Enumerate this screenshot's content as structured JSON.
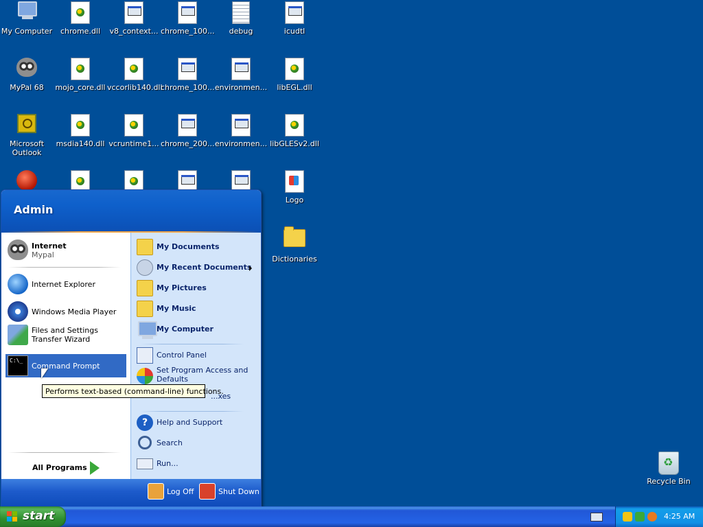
{
  "desktop": {
    "icons": [
      {
        "label": "My Computer"
      },
      {
        "label": "chrome.dll"
      },
      {
        "label": "v8_context..."
      },
      {
        "label": "chrome_100..."
      },
      {
        "label": "debug"
      },
      {
        "label": "icudtl"
      },
      {
        "label": "MyPal 68"
      },
      {
        "label": "mojo_core.dll"
      },
      {
        "label": "vccorlib140.dll"
      },
      {
        "label": "chrome_100..."
      },
      {
        "label": "environmen..."
      },
      {
        "label": "libEGL.dll"
      },
      {
        "label": "Microsoft Outlook"
      },
      {
        "label": "msdia140.dll"
      },
      {
        "label": "vcruntime1..."
      },
      {
        "label": "chrome_200..."
      },
      {
        "label": "environmen..."
      },
      {
        "label": "libGLESv2.dll"
      },
      {
        "label": "Logo"
      },
      {
        "label": "Dictionaries"
      },
      {
        "label": "Recycle Bin"
      }
    ]
  },
  "start_menu": {
    "user": "Admin",
    "pinned": [
      {
        "title": "Internet",
        "subtitle": "Mypal"
      }
    ],
    "recent": [
      {
        "title": "Internet Explorer"
      },
      {
        "title": "Windows Media Player"
      },
      {
        "title": "Files and Settings Transfer Wizard"
      },
      {
        "title": "Command Prompt"
      }
    ],
    "all_programs": "All Programs",
    "places": [
      {
        "title": "My Documents"
      },
      {
        "title": "My Recent Documents"
      },
      {
        "title": "My Pictures"
      },
      {
        "title": "My Music"
      },
      {
        "title": "My Computer"
      }
    ],
    "system": [
      {
        "title": "Control Panel"
      },
      {
        "title": "Set Program Access and Defaults"
      },
      {
        "title": "...xes"
      }
    ],
    "tools": [
      {
        "title": "Help and Support"
      },
      {
        "title": "Search"
      },
      {
        "title": "Run..."
      }
    ],
    "log_off": "Log Off",
    "shut_down": "Shut Down"
  },
  "tooltip": "Performs text-based (command-line) functions.",
  "taskbar": {
    "start_label": "start",
    "clock": "4:25 AM"
  },
  "colors": {
    "desktop_bg": "#004e98",
    "highlight": "#316ac5",
    "start_green": "#3c9b3c"
  }
}
